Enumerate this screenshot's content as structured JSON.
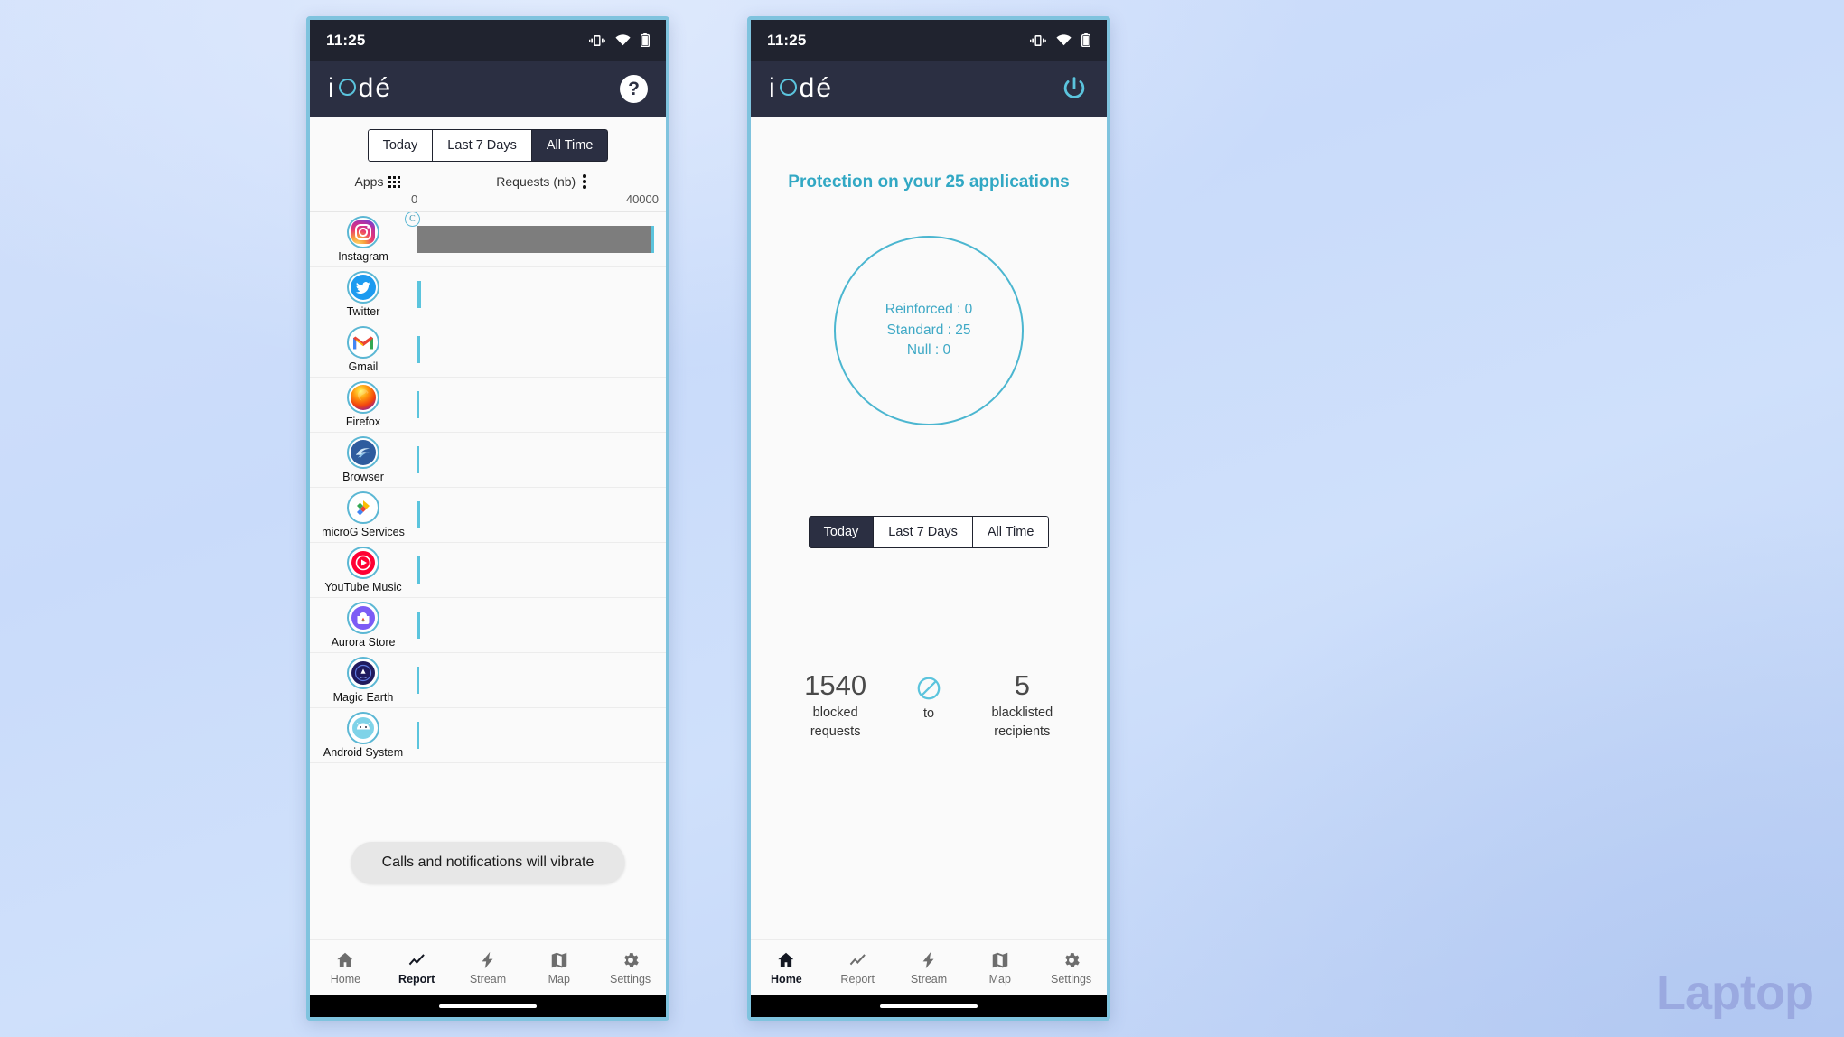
{
  "watermark": "Laptop",
  "accent_cyan": "#5bc4dd",
  "dark_navy": "#2b2f42",
  "status_bar": {
    "time": "11:25",
    "icons": [
      "vibrate-icon",
      "wifi-icon",
      "battery-icon"
    ]
  },
  "brand": {
    "name": "iodé",
    "pre": "i",
    "post": "dé"
  },
  "left_phone": {
    "appbar": {
      "help_label": "?"
    },
    "segments": [
      {
        "label": "Today",
        "active": false
      },
      {
        "label": "Last 7 Days",
        "active": false
      },
      {
        "label": "All Time",
        "active": true
      }
    ],
    "chart_header": {
      "apps_label": "Apps",
      "requests_label": "Requests (nb)"
    },
    "axis": {
      "min": "0",
      "max": "40000"
    },
    "toast": "Calls and notifications will vibrate",
    "nav": [
      {
        "label": "Home",
        "icon": "home-icon",
        "active": false
      },
      {
        "label": "Report",
        "icon": "trending-line-icon",
        "active": true
      },
      {
        "label": "Stream",
        "icon": "lightning-bolt-icon",
        "active": false
      },
      {
        "label": "Map",
        "icon": "map-icon",
        "active": false
      },
      {
        "label": "Settings",
        "icon": "gear-icon",
        "active": false
      }
    ]
  },
  "right_phone": {
    "appbar": {
      "power_icon": "power-icon"
    },
    "protection_title": "Protection on your 25 applications",
    "donut": {
      "reinforced": "Reinforced : 0",
      "standard": "Standard : 25",
      "null_line": "Null : 0"
    },
    "segments": [
      {
        "label": "Today",
        "active": true
      },
      {
        "label": "Last 7 Days",
        "active": false
      },
      {
        "label": "All Time",
        "active": false
      }
    ],
    "stats": {
      "blocked_value": "1540",
      "blocked_label_1": "blocked",
      "blocked_label_2": "requests",
      "middle_label": "to",
      "middle_icon": "block-icon",
      "blacklist_value": "5",
      "blacklist_label_1": "blacklisted",
      "blacklist_label_2": "recipients"
    },
    "nav": [
      {
        "label": "Home",
        "icon": "home-icon",
        "active": true
      },
      {
        "label": "Report",
        "icon": "trending-line-icon",
        "active": false
      },
      {
        "label": "Stream",
        "icon": "lightning-bolt-icon",
        "active": false
      },
      {
        "label": "Map",
        "icon": "map-icon",
        "active": false
      },
      {
        "label": "Settings",
        "icon": "gear-icon",
        "active": false
      }
    ]
  },
  "chart_data": {
    "type": "bar",
    "title": "Requests (nb)",
    "xlabel": "Requests (nb)",
    "ylabel": "Apps",
    "xlim": [
      0,
      40000
    ],
    "grid": false,
    "legend": "none",
    "categories": [
      "Instagram",
      "Twitter",
      "Gmail",
      "Firefox",
      "Browser",
      "microG Services",
      "YouTube Music",
      "Aurora Store",
      "Magic Earth",
      "Android System"
    ],
    "values": [
      39400,
      250,
      230,
      150,
      150,
      170,
      160,
      160,
      150,
      140
    ],
    "bar_styles": [
      "grey-with-cyan-cap",
      "cyan",
      "cyan",
      "cyan",
      "cyan",
      "cyan",
      "cyan",
      "cyan",
      "cyan",
      "cyan"
    ],
    "badges": {
      "Instagram": "C"
    }
  }
}
